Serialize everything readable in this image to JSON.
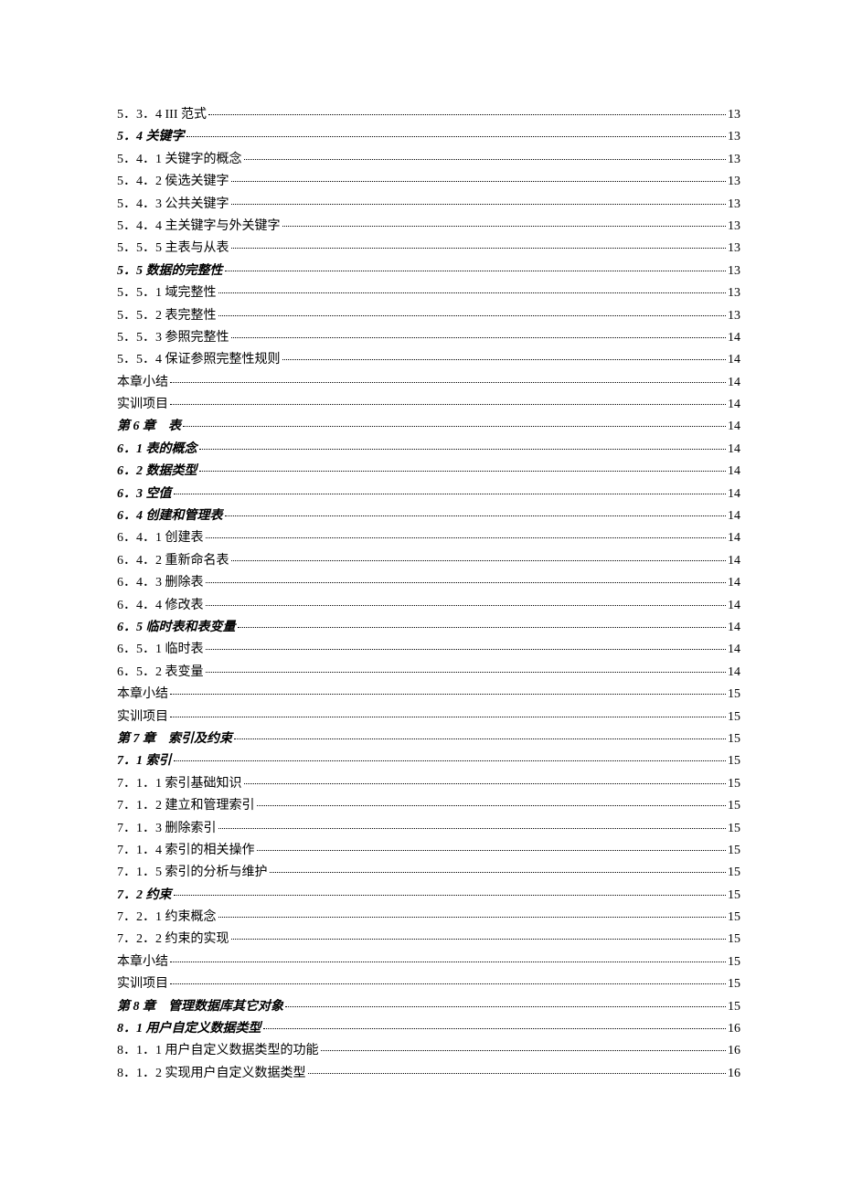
{
  "toc": [
    {
      "label": "5．3．4 III 范式",
      "page": "13",
      "style": ""
    },
    {
      "label": "5．4 关键字",
      "page": "13",
      "style": "italic bold"
    },
    {
      "label": "5．4．1 关键字的概念",
      "page": "13",
      "style": ""
    },
    {
      "label": "5．4．2 侯选关键字",
      "page": "13",
      "style": ""
    },
    {
      "label": "5．4．3 公共关键字",
      "page": "13",
      "style": ""
    },
    {
      "label": "5．4．4 主关键字与外关键字",
      "page": "13",
      "style": ""
    },
    {
      "label": "5．5．5 主表与从表",
      "page": "13",
      "style": ""
    },
    {
      "label": "5．5 数据的完整性",
      "page": "13",
      "style": "italic bold"
    },
    {
      "label": "5．5．1 域完整性",
      "page": "13",
      "style": ""
    },
    {
      "label": "5．5．2 表完整性",
      "page": "13",
      "style": ""
    },
    {
      "label": "5．5．3 参照完整性",
      "page": "14",
      "style": ""
    },
    {
      "label": "5．5．4 保证参照完整性规则",
      "page": "14",
      "style": ""
    },
    {
      "label": "本章小结",
      "page": "14",
      "style": ""
    },
    {
      "label": "实训项目",
      "page": "14",
      "style": ""
    },
    {
      "label": "第 6 章　表",
      "page": "14",
      "style": "italic bold"
    },
    {
      "label": "6．1 表的概念",
      "page": "14",
      "style": "italic bold"
    },
    {
      "label": "6．2 数据类型",
      "page": "14",
      "style": "italic bold"
    },
    {
      "label": "6．3 空值",
      "page": "14",
      "style": "italic bold"
    },
    {
      "label": "6．4 创建和管理表",
      "page": "14",
      "style": "italic bold"
    },
    {
      "label": "6．4．1 创建表",
      "page": "14",
      "style": ""
    },
    {
      "label": "6．4．2 重新命名表",
      "page": "14",
      "style": ""
    },
    {
      "label": "6．4．3 删除表",
      "page": "14",
      "style": ""
    },
    {
      "label": "6．4．4 修改表",
      "page": "14",
      "style": ""
    },
    {
      "label": "6．5 临时表和表变量",
      "page": "14",
      "style": "italic bold"
    },
    {
      "label": "6．5．1 临时表",
      "page": "14",
      "style": ""
    },
    {
      "label": "6．5．2 表变量",
      "page": "14",
      "style": ""
    },
    {
      "label": "本章小结",
      "page": "15",
      "style": ""
    },
    {
      "label": "实训项目",
      "page": "15",
      "style": ""
    },
    {
      "label": "第 7 章　索引及约束",
      "page": "15",
      "style": "italic bold"
    },
    {
      "label": "7．1 索引",
      "page": "15",
      "style": "italic bold"
    },
    {
      "label": "7．1．1 索引基础知识",
      "page": "15",
      "style": ""
    },
    {
      "label": "7．1．2 建立和管理索引",
      "page": "15",
      "style": ""
    },
    {
      "label": "7．1．3 删除索引",
      "page": "15",
      "style": ""
    },
    {
      "label": "7．1．4 索引的相关操作",
      "page": "15",
      "style": ""
    },
    {
      "label": "7．1．5 索引的分析与维护",
      "page": "15",
      "style": ""
    },
    {
      "label": "7．2 约束",
      "page": "15",
      "style": "italic bold"
    },
    {
      "label": "7．2．1 约束概念",
      "page": "15",
      "style": ""
    },
    {
      "label": "7．2．2 约束的实现",
      "page": "15",
      "style": ""
    },
    {
      "label": "本章小结",
      "page": "15",
      "style": ""
    },
    {
      "label": "实训项目",
      "page": "15",
      "style": ""
    },
    {
      "label": "第 8 章　管理数据库其它对象",
      "page": "15",
      "style": "italic bold"
    },
    {
      "label": "8．1 用户自定义数据类型",
      "page": "16",
      "style": "italic bold"
    },
    {
      "label": "8．1．1 用户自定义数据类型的功能",
      "page": "16",
      "style": ""
    },
    {
      "label": "8．1．2 实现用户自定义数据类型",
      "page": "16",
      "style": ""
    }
  ]
}
